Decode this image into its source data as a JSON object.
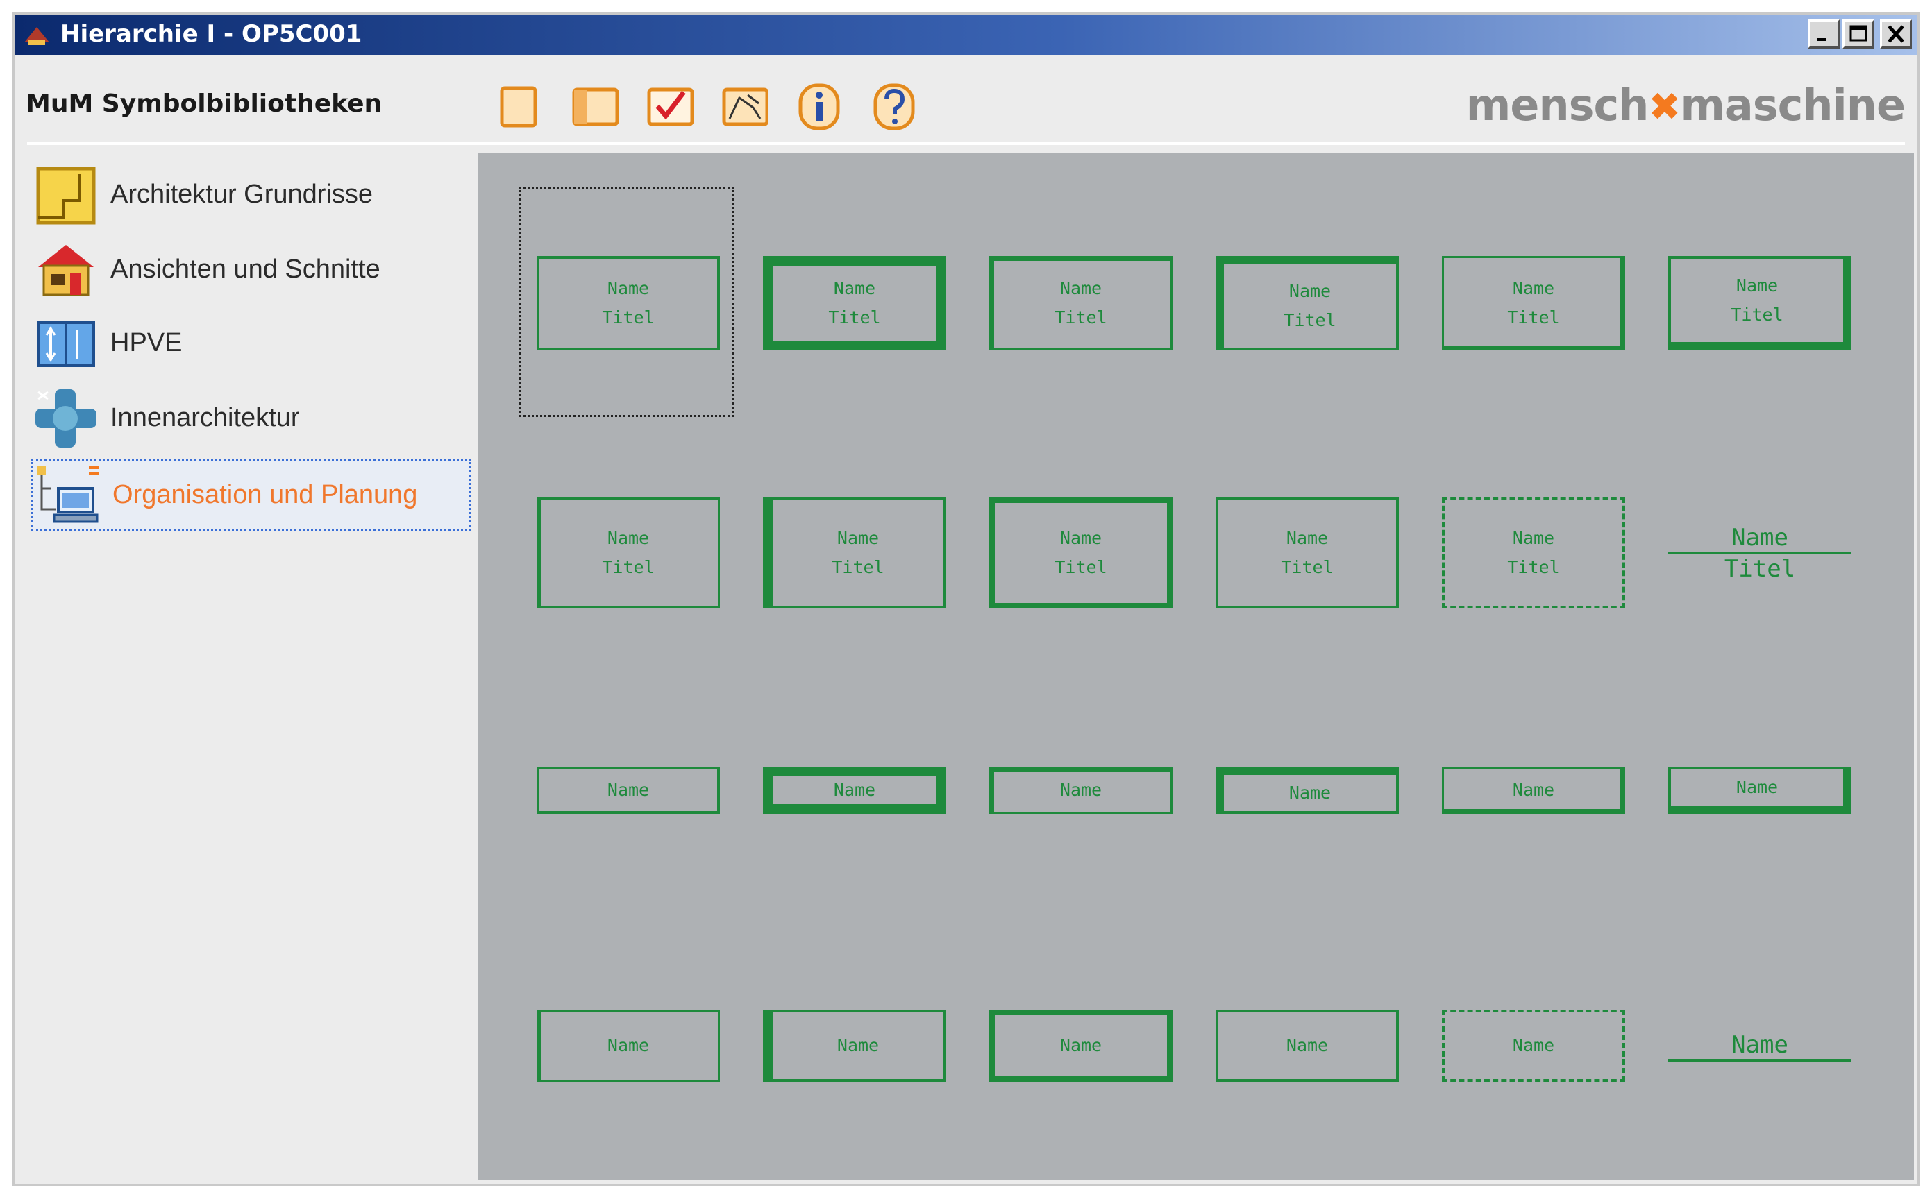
{
  "window": {
    "title": "Hierarchie I - OP5C001",
    "controls": {
      "minimize": "minimize-icon",
      "maximize": "maximize-icon",
      "close": "close-icon"
    }
  },
  "header": {
    "library_title": "MuM Symbolbibliotheken",
    "logo": {
      "left": "mensch",
      "right": "maschine"
    },
    "tools": [
      "new-symbol-icon",
      "panel-icon",
      "check-icon",
      "edit-icon",
      "info-icon",
      "help-icon"
    ]
  },
  "sidebar": {
    "items": [
      {
        "label": "Architektur Grundrisse",
        "icon": "floorplan-icon",
        "selected": false
      },
      {
        "label": "Ansichten und Schnitte",
        "icon": "house-icon",
        "selected": false
      },
      {
        "label": "HPVE",
        "icon": "hpve-icon",
        "selected": false
      },
      {
        "label": "Innenarchitektur",
        "icon": "interior-icon",
        "selected": false
      },
      {
        "label": "Organisation und Planung",
        "icon": "organisation-icon",
        "selected": true
      }
    ]
  },
  "symbols": {
    "name_label": "Name",
    "title_label": "Titel",
    "rows": [
      [
        "plain",
        "thick",
        "double-top-left",
        "thick-top-left",
        "double-bottom-right",
        "thick-bottom-right"
      ],
      [
        "double-left",
        "thick-left",
        "thick-all",
        "plain",
        "dashed",
        "underline"
      ],
      [
        "plain",
        "thick",
        "double-top-left",
        "thick-top-left",
        "double-bottom-right",
        "thick-bottom-right"
      ],
      [
        "double-left",
        "thick-left",
        "thick-all",
        "plain",
        "dashed",
        "underline"
      ]
    ]
  },
  "colors": {
    "symbol_green": "#1e8a3c",
    "panel_gray": "#aeb1b4",
    "selected_text": "#f0772c"
  }
}
